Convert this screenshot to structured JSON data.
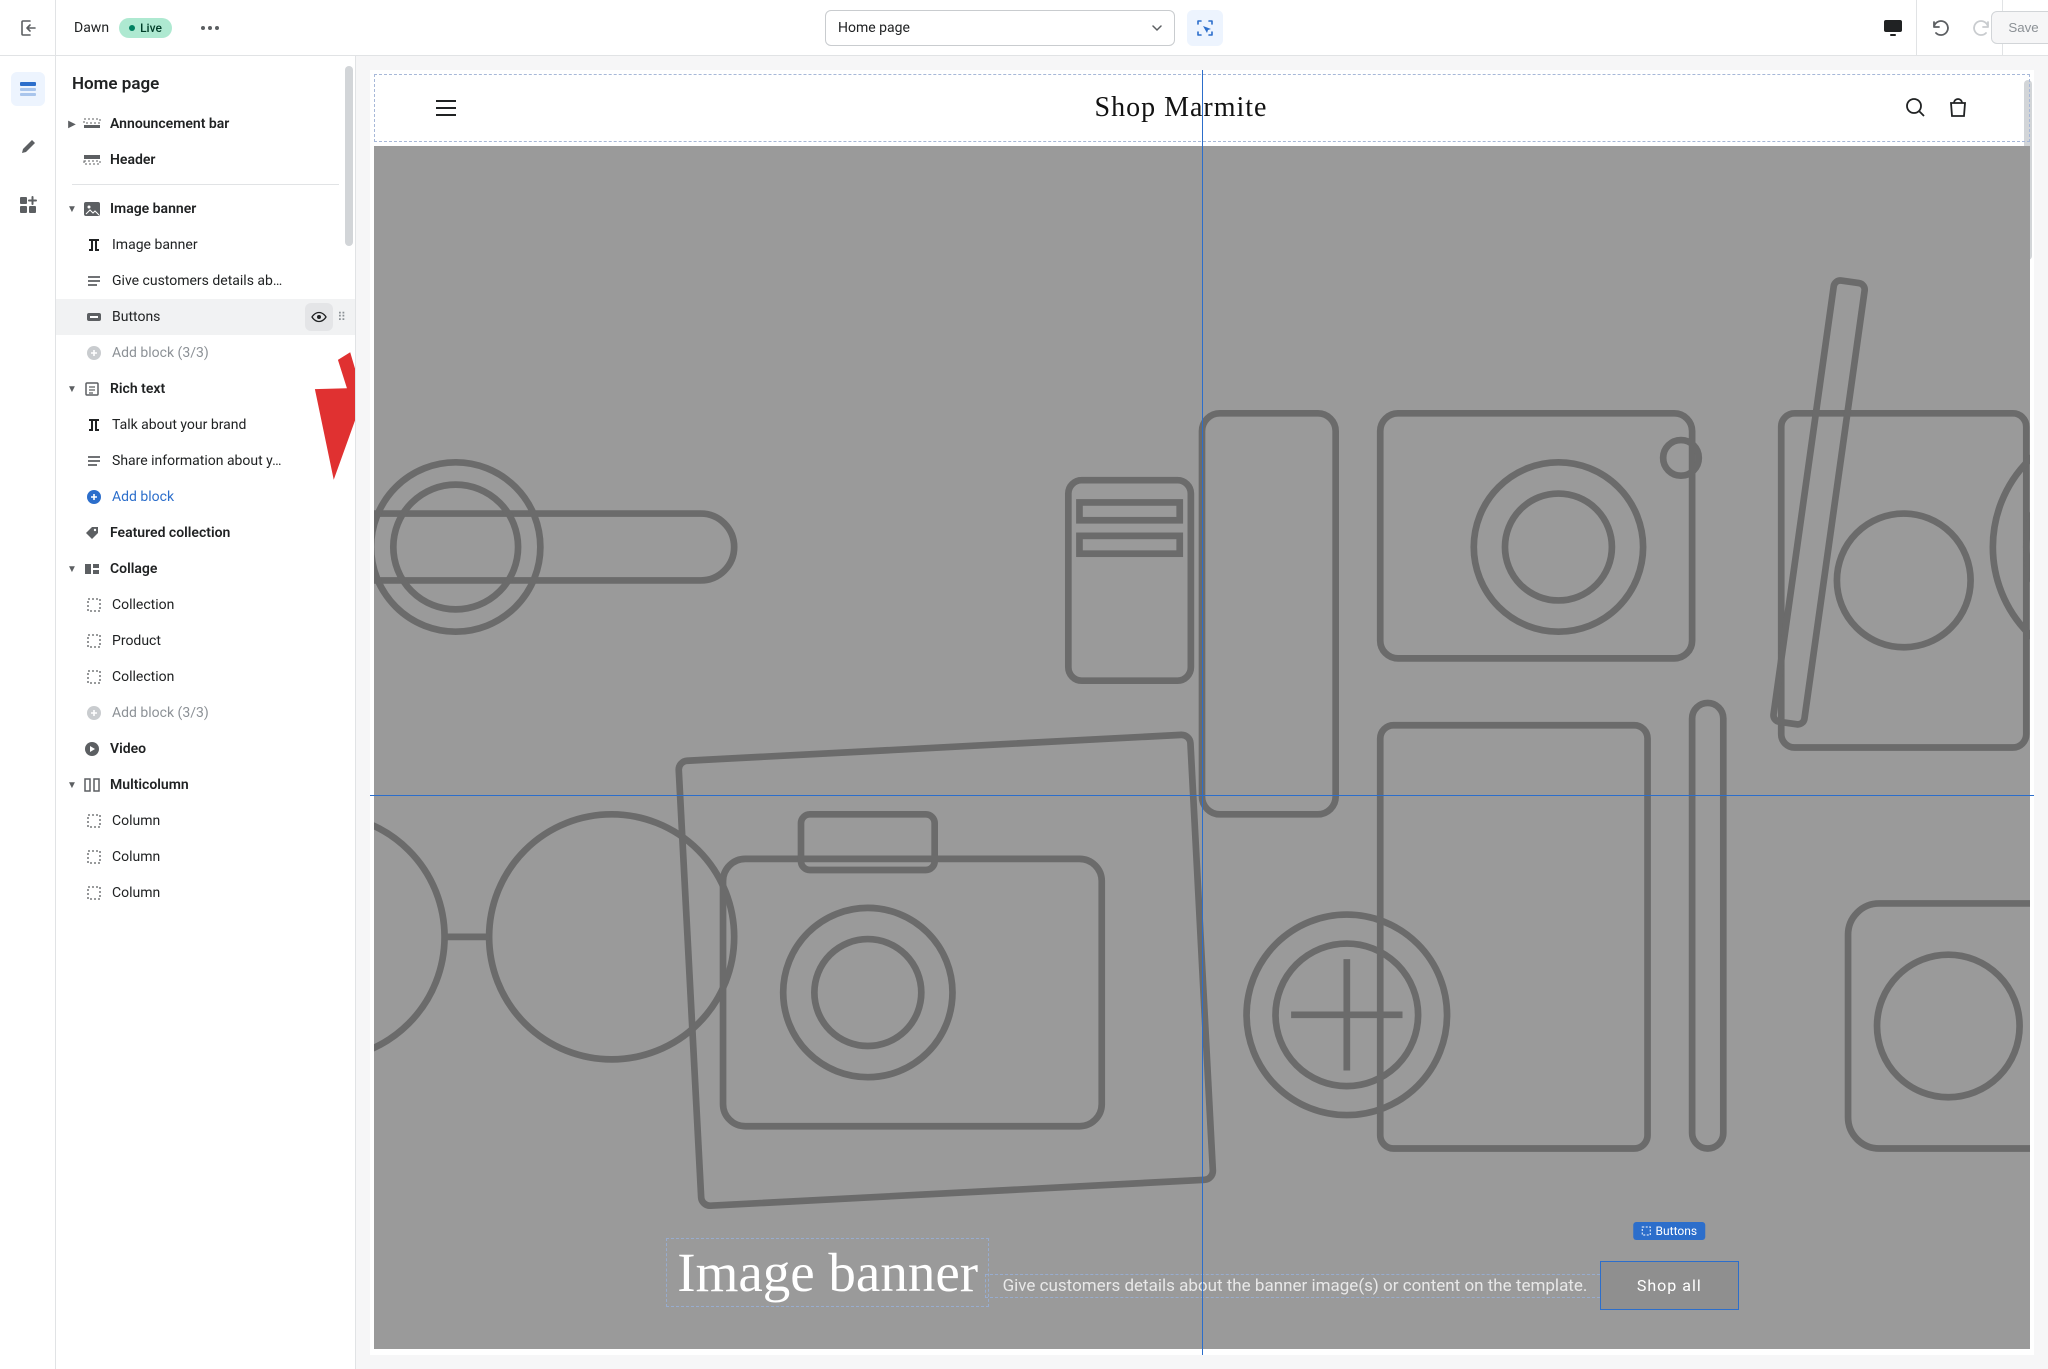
{
  "topbar": {
    "theme_name": "Dawn",
    "status": "Live",
    "page_selector": "Home page",
    "save": "Save"
  },
  "sidebar": {
    "title": "Home page",
    "sections": {
      "announcement": "Announcement bar",
      "header": "Header",
      "image_banner": {
        "label": "Image banner",
        "blocks": {
          "heading": "Image banner",
          "text": "Give customers details ab…",
          "buttons": "Buttons",
          "add": "Add block (3/3)"
        }
      },
      "rich_text": {
        "label": "Rich text",
        "blocks": {
          "heading": "Talk about your brand",
          "text": "Share information about y…",
          "add": "Add block"
        }
      },
      "featured": "Featured collection",
      "collage": {
        "label": "Collage",
        "blocks": {
          "b1": "Collection",
          "b2": "Product",
          "b3": "Collection",
          "add": "Add block (3/3)"
        }
      },
      "video": "Video",
      "multicolumn": {
        "label": "Multicolumn",
        "blocks": {
          "c1": "Column",
          "c2": "Column",
          "c3": "Column"
        }
      }
    }
  },
  "preview": {
    "store_name": "Shop Marmite",
    "banner_title": "Image banner",
    "banner_subtitle": "Give customers details about the banner image(s) or content on the template.",
    "button_label": "Shop all",
    "selection_tag": "Buttons"
  }
}
